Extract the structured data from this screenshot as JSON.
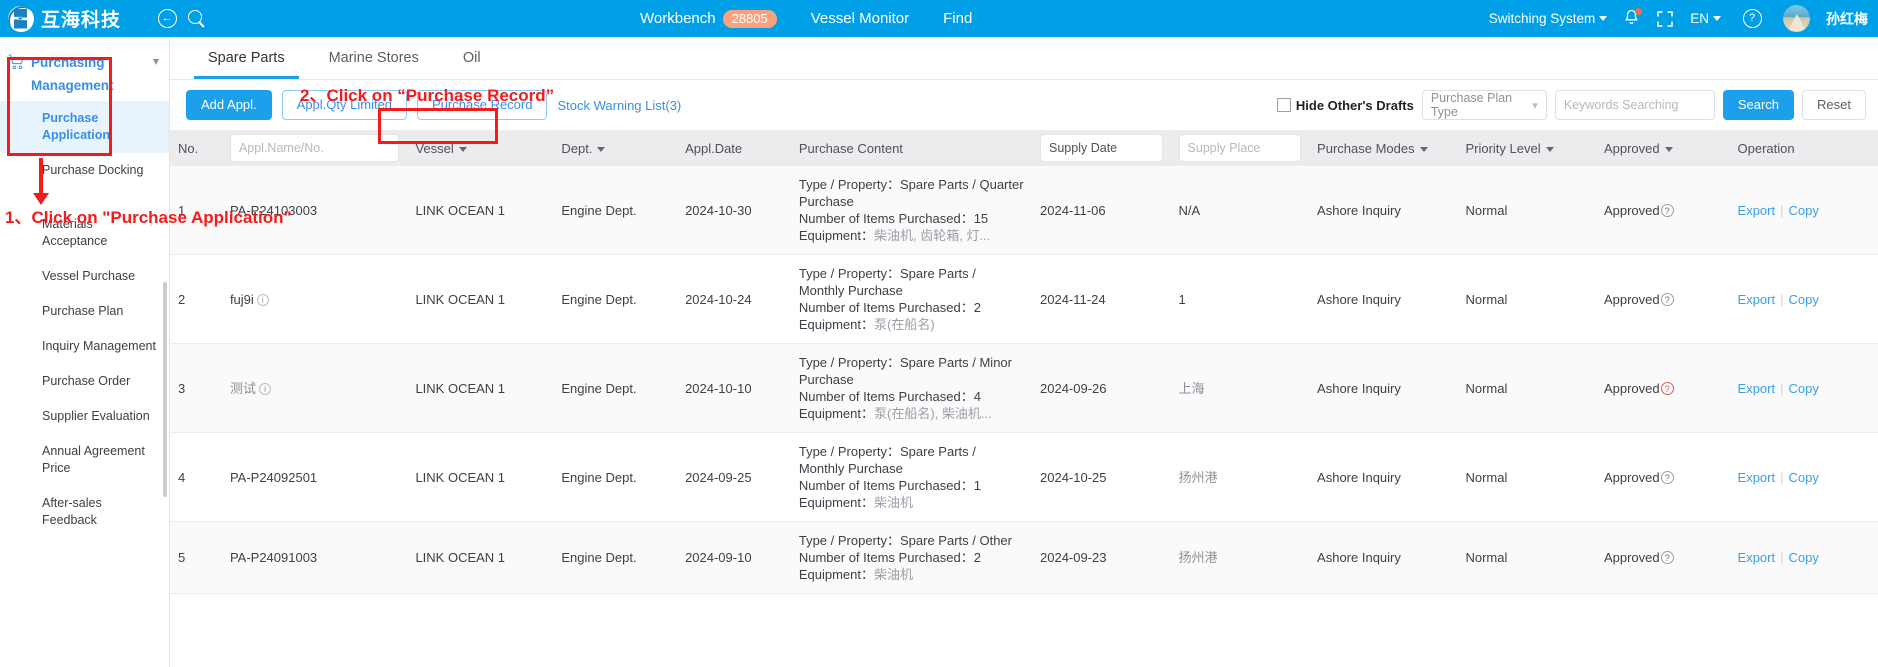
{
  "header": {
    "brand": "互海科技",
    "back_icon": "back-arrow-icon",
    "search_icon": "search-icon",
    "nav": [
      {
        "label": "Workbench",
        "badge": "28805"
      },
      {
        "label": "Vessel Monitor"
      },
      {
        "label": "Find"
      }
    ],
    "switching_system": "Switching System",
    "language": "EN",
    "user_name": "孙红梅"
  },
  "sidebar": {
    "group_label_line1": "Purchasing",
    "group_label_line2": "Management",
    "items": [
      {
        "label": "Purchase Application",
        "active": true
      },
      {
        "label": "Purchase Docking",
        "active": false
      },
      {
        "label": "Materials Acceptance",
        "active": false,
        "has_arrow": true
      },
      {
        "label": "Vessel Purchase",
        "active": false
      },
      {
        "label": "Purchase Plan",
        "active": false
      },
      {
        "label": "Inquiry Management",
        "active": false
      },
      {
        "label": "Purchase Order",
        "active": false
      },
      {
        "label": "Supplier Evaluation",
        "active": false
      },
      {
        "label": "Annual Agreement Price",
        "active": false
      },
      {
        "label": "After-sales Feedback",
        "active": false
      }
    ]
  },
  "tabs": [
    {
      "label": "Spare Parts",
      "active": true
    },
    {
      "label": "Marine Stores",
      "active": false
    },
    {
      "label": "Oil",
      "active": false
    }
  ],
  "toolbar": {
    "add_appl": "Add Appl.",
    "appl_qty_limited": "Appl.Qty Limited",
    "purchase_record": "Purchase Record",
    "stock_warning": "Stock Warning List(3)",
    "hide_drafts": "Hide Other's Drafts",
    "plan_type_placeholder": "Purchase Plan Type",
    "keywords_placeholder": "Keywords Searching",
    "search": "Search",
    "reset": "Reset"
  },
  "table": {
    "columns": [
      {
        "key": "no",
        "label": "No."
      },
      {
        "key": "appl_name",
        "label": "",
        "input_placeholder": "Appl.Name/No."
      },
      {
        "key": "vessel",
        "label": "Vessel",
        "filter": true
      },
      {
        "key": "dept",
        "label": "Dept.",
        "filter": true
      },
      {
        "key": "appl_date",
        "label": "Appl.Date"
      },
      {
        "key": "content",
        "label": "Purchase Content"
      },
      {
        "key": "supply_date",
        "label": "",
        "input_placeholder": "Supply Date"
      },
      {
        "key": "supply_place",
        "label": "",
        "input_placeholder": "Supply Place"
      },
      {
        "key": "purchase_modes",
        "label": "Purchase Modes",
        "filter": true
      },
      {
        "key": "priority",
        "label": "Priority Level",
        "filter": true
      },
      {
        "key": "approved",
        "label": "Approved",
        "filter": true
      },
      {
        "key": "operation",
        "label": "Operation"
      }
    ],
    "content_labels": {
      "type_property": "Type / Property：",
      "number_items": "Number of Items Purchased：",
      "equipment": "Equipment："
    },
    "operation_links": {
      "export": "Export",
      "copy": "Copy"
    },
    "rows": [
      {
        "no": "1",
        "appl_name": "PA-P24103003",
        "has_info_icon": false,
        "vessel": "LINK OCEAN 1",
        "dept": "Engine Dept.",
        "appl_date": "2024-10-30",
        "type_property": "Spare Parts / Quarter Purchase",
        "number_items": "15",
        "equipment": "柴油机, 齿轮箱, 灯...",
        "supply_date": "2024-11-06",
        "supply_place": "N/A",
        "supply_place_grey": false,
        "purchase_modes": "Ashore Inquiry",
        "priority": "Normal",
        "approved": "Approved",
        "approved_red": false
      },
      {
        "no": "2",
        "appl_name": "fuj9i",
        "has_info_icon": true,
        "vessel": "LINK OCEAN 1",
        "dept": "Engine Dept.",
        "appl_date": "2024-10-24",
        "type_property": "Spare Parts / Monthly Purchase",
        "number_items": "2",
        "equipment": "泵(在船名)",
        "supply_date": "2024-11-24",
        "supply_place": "1",
        "supply_place_grey": false,
        "purchase_modes": "Ashore Inquiry",
        "priority": "Normal",
        "approved": "Approved",
        "approved_red": false
      },
      {
        "no": "3",
        "appl_name": "测试",
        "has_info_icon": true,
        "appl_name_grey": true,
        "vessel": "LINK OCEAN 1",
        "dept": "Engine Dept.",
        "appl_date": "2024-10-10",
        "type_property": "Spare Parts / Minor Purchase",
        "number_items": "4",
        "equipment": "泵(在船名), 柴油机...",
        "supply_date": "2024-09-26",
        "supply_place": "上海",
        "supply_place_grey": true,
        "purchase_modes": "Ashore Inquiry",
        "priority": "Normal",
        "approved": "Approved",
        "approved_red": true
      },
      {
        "no": "4",
        "appl_name": "PA-P24092501",
        "has_info_icon": false,
        "vessel": "LINK OCEAN 1",
        "dept": "Engine Dept.",
        "appl_date": "2024-09-25",
        "type_property": "Spare Parts / Monthly Purchase",
        "number_items": "1",
        "equipment": "柴油机",
        "supply_date": "2024-10-25",
        "supply_place": "扬州港",
        "supply_place_grey": true,
        "purchase_modes": "Ashore Inquiry",
        "priority": "Normal",
        "approved": "Approved",
        "approved_red": false
      },
      {
        "no": "5",
        "appl_name": "PA-P24091003",
        "has_info_icon": false,
        "vessel": "LINK OCEAN 1",
        "dept": "Engine Dept.",
        "appl_date": "2024-09-10",
        "type_property": "Spare Parts / Other",
        "number_items": "2",
        "equipment": "柴油机",
        "supply_date": "2024-09-23",
        "supply_place": "扬州港",
        "supply_place_grey": true,
        "purchase_modes": "Ashore Inquiry",
        "priority": "Normal",
        "approved": "Approved",
        "approved_red": false
      }
    ]
  },
  "annotations": {
    "step1": "1、Click on \"Purchase Application\"",
    "step2": "2、Click on “Purchase Record”"
  },
  "colors": {
    "brand_blue": "#00a0e9",
    "accent_blue": "#1da0ec",
    "link_blue": "#3a8ee6",
    "annotation_red": "#f51b1b",
    "badge_orange": "#fca17d"
  }
}
